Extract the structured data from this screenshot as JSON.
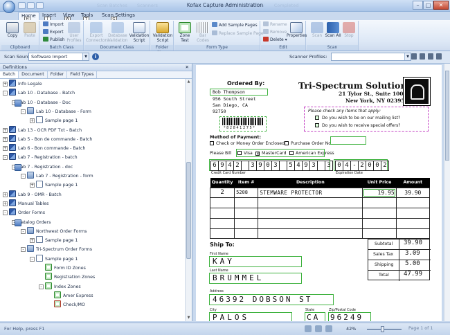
{
  "window": {
    "title": "Kofax Capture Administration",
    "faded_tabs": [
      "Scan Batches",
      "Scanners",
      "Batches",
      "Workflow",
      "Completed"
    ]
  },
  "ribbon_tabs": [
    {
      "label": "Home",
      "key": "H"
    },
    {
      "label": "Insert",
      "key": "I"
    },
    {
      "label": "View",
      "key": "W"
    },
    {
      "label": "Tools",
      "key": "T"
    },
    {
      "label": "Scan Settings",
      "key": "G"
    }
  ],
  "groups": {
    "clipboard": {
      "label": "Clipboard",
      "copy": "Copy",
      "paste": "Paste"
    },
    "batch_class": {
      "label": "Batch Class",
      "import": "Import",
      "export": "Export",
      "publish": "Publish",
      "user_profiles": "User Profiles"
    },
    "document_class": {
      "label": "Document Class",
      "export_connectors": "Export Connectors",
      "database_validation": "Database Validation",
      "validation_script": "Validation Script"
    },
    "folder_class": {
      "label": "Folder Class",
      "validation_script": "Validation Script"
    },
    "form_type": {
      "label": "Form Type",
      "zone_test": "Zone Test",
      "bar_codes": "Bar Codes",
      "add_sample_pages": "Add Sample Pages",
      "replace_sample_page": "Replace Sample Page"
    },
    "edit": {
      "label": "Edit",
      "rename": "Rename",
      "remove": "Remove",
      "delete": "Delete",
      "properties": "Properties"
    },
    "scan": {
      "label": "Scan",
      "scan": "Scan",
      "scan_all": "Scan All",
      "stop": "Stop"
    }
  },
  "scan_source": {
    "label": "Scan Source:",
    "value": "Software Import",
    "scanner_profiles_label": "Scanner Profiles:"
  },
  "definitions": {
    "title": "Definitions",
    "tabs": [
      "Batch",
      "Document",
      "Folder",
      "Field Types"
    ],
    "tree": [
      {
        "label": "Info Legale",
        "level": 1,
        "icon": "batch",
        "toggle": "+"
      },
      {
        "label": "Lab 10 - Database - Batch",
        "level": 1,
        "icon": "batch",
        "toggle": "-"
      },
      {
        "label": "Lab 10 - Database - Doc",
        "level": 2,
        "icon": "doc",
        "toggle": "-"
      },
      {
        "label": "Lab 10 - Database - Form",
        "level": 3,
        "icon": "form",
        "toggle": "-"
      },
      {
        "label": "Sample page 1",
        "level": 4,
        "icon": "page",
        "toggle": "+"
      },
      {
        "label": "Lab 13 - OCR PDF Txt - Batch",
        "level": 1,
        "icon": "batch",
        "toggle": "+"
      },
      {
        "label": "Lab 5 - Bon de commande - Batch",
        "level": 1,
        "icon": "batch",
        "toggle": "+"
      },
      {
        "label": "Lab 6 - Bon commande - Batch",
        "level": 1,
        "icon": "batch",
        "toggle": "+"
      },
      {
        "label": "Lab 7 - Registration - batch",
        "level": 1,
        "icon": "batch",
        "toggle": "-"
      },
      {
        "label": "Lab 7 - Registration - doc",
        "level": 2,
        "icon": "doc",
        "toggle": "-"
      },
      {
        "label": "Lab 7 - Registration - form",
        "level": 3,
        "icon": "form",
        "toggle": "-"
      },
      {
        "label": "Sample page 1",
        "level": 4,
        "icon": "page",
        "toggle": "+"
      },
      {
        "label": "Lab 9 - OMR - Batch",
        "level": 1,
        "icon": "batch",
        "toggle": "+"
      },
      {
        "label": "Manual Tables",
        "level": 1,
        "icon": "batch",
        "toggle": "+"
      },
      {
        "label": "Order Forms",
        "level": 1,
        "icon": "batch",
        "toggle": "-"
      },
      {
        "label": "Catalog Orders",
        "level": 2,
        "icon": "doc",
        "toggle": "-"
      },
      {
        "label": "Northwest Order Forms",
        "level": 3,
        "icon": "form",
        "toggle": "-"
      },
      {
        "label": "Sample page 1",
        "level": 4,
        "icon": "page",
        "toggle": "+"
      },
      {
        "label": "Tri-Spectrum Order Forms",
        "level": 3,
        "icon": "form",
        "toggle": "-"
      },
      {
        "label": "Sample page 1",
        "level": 4,
        "icon": "page",
        "toggle": "-"
      },
      {
        "label": "Form ID Zones",
        "level": 5,
        "icon": "zone",
        "toggle": ""
      },
      {
        "label": "Registration Zones",
        "level": 5,
        "icon": "zone",
        "toggle": ""
      },
      {
        "label": "Index Zones",
        "level": 5,
        "icon": "zone",
        "toggle": "-"
      },
      {
        "label": "Amer Express",
        "level": 6,
        "icon": "zone",
        "toggle": ""
      },
      {
        "label": "Check/MO",
        "level": 6,
        "icon": "zone red",
        "toggle": ""
      }
    ]
  },
  "form": {
    "ordered_by": "Ordered By:",
    "name": "Bob Thompson",
    "street": "956 South Street",
    "city": "San Diego, CA",
    "zip": "92750",
    "barcode_text": "* 8 2 8 4 1 2 7 5 *",
    "company": "Tri-Spectrum Solutions",
    "company_addr1": "21 Tylor St., Suite 100",
    "company_addr2": "New York, NY  02395",
    "special_prompt": "Please check any items that apply:",
    "mailing_list": "Do you wish to be on our mailing list?",
    "special_offers": "Do you wish to receive special offers?",
    "method_of_payment": "Method of Payment:",
    "check_money": "Check or Money Order Enclosed",
    "purchase_order": "Purchase Order No.",
    "please_bill": "Please Bill",
    "visa": "Visa",
    "mastercard": "MasterCard",
    "amex": "American Express",
    "card_number_digits": [
      "6",
      "9",
      "4",
      "2",
      "",
      "3",
      "9",
      "0",
      "3",
      "",
      "5",
      "4",
      "9",
      "3",
      "",
      "3"
    ],
    "card_number_label": "Credit Card Number",
    "expiration_digits": [
      "0",
      "4",
      "-",
      "2",
      "0",
      "0",
      "2"
    ],
    "expiration_label": "Expiration Date",
    "table_headers": [
      "Quantity",
      "Item #",
      "Description",
      "Unit Price",
      "Amount"
    ],
    "row1": {
      "quantity": "2",
      "item": "5208",
      "description": "STEMWARE PROTECTOR",
      "unit_price": "19.95",
      "amount": "39.90"
    },
    "ship_to": "Ship To:",
    "subtotal_label": "Subtotal",
    "subtotal": "39.90",
    "sales_tax_label": "Sales Tax",
    "sales_tax": "3.09",
    "shipping_label": "Shipping",
    "shipping": "5.00",
    "total_label": "Total",
    "total": "47.99",
    "first_name_label": "First Name",
    "first_name": "KAY",
    "last_name_label": "Last Name",
    "last_name": "BRUMMEL",
    "address_label": "Address",
    "address": "46392  DOBSON  ST",
    "city_label": "City",
    "city_value": "PALOS",
    "state_label": "State",
    "state_value": "CA",
    "zip_label": "Zip/Postal Code",
    "zip_value": "96249"
  },
  "status": {
    "help": "For Help, press F1",
    "zoom": "42%",
    "page": "Page 1 of 1"
  }
}
